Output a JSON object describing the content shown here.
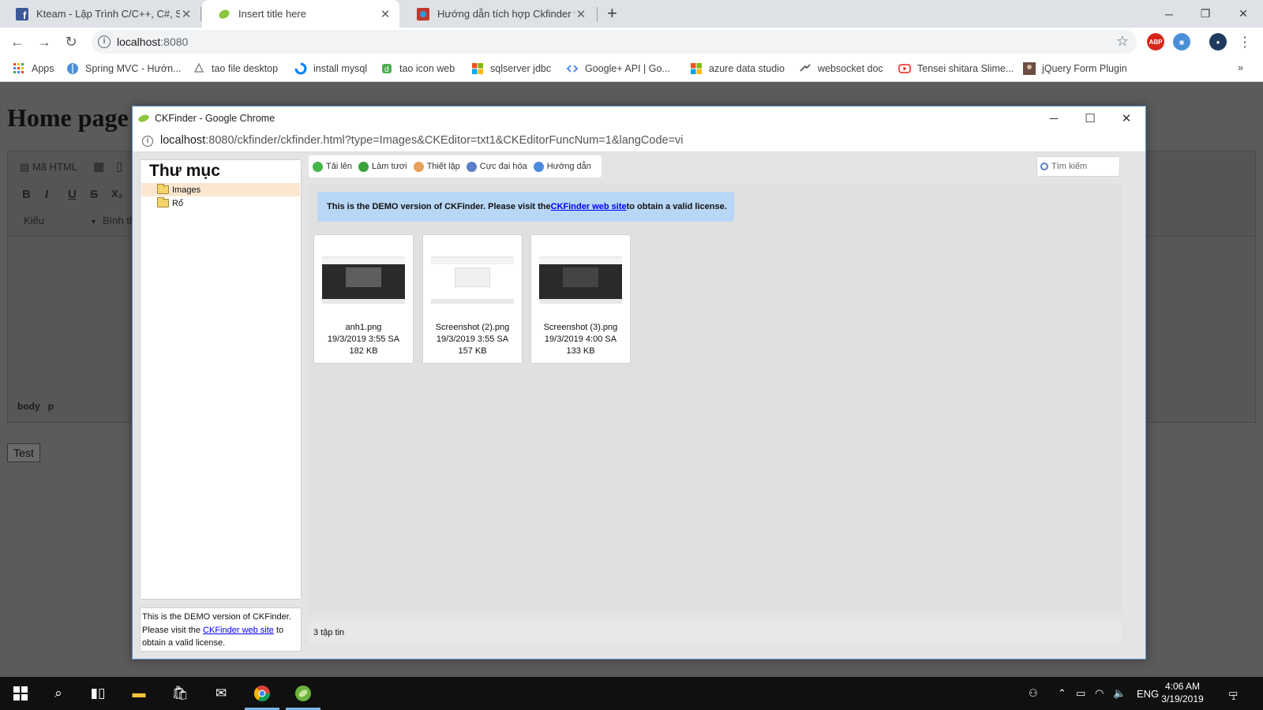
{
  "browser": {
    "tabs": [
      {
        "title": "Kteam - Lập Trình C/C++, C#, SQL",
        "icon": "facebook-icon",
        "active": false
      },
      {
        "title": "Insert title here",
        "icon": "spring-leaf-icon",
        "active": true
      },
      {
        "title": "Hướng dẫn tích hợp Ckfinder vào",
        "icon": "howkteam-icon",
        "active": false
      }
    ],
    "url_host": "localhost",
    "url_port": ":8080",
    "bookmarks": [
      {
        "label": "Apps",
        "icon": "apps-grid-icon"
      },
      {
        "label": "Spring MVC - Hướn...",
        "icon": "globe-icon"
      },
      {
        "label": "tao file desktop",
        "icon": "recycle-icon"
      },
      {
        "label": "install mysql",
        "icon": "digitalocean-icon"
      },
      {
        "label": "tao icon web",
        "icon": "d-logo-icon"
      },
      {
        "label": "sqlserver jdbc",
        "icon": "microsoft-icon"
      },
      {
        "label": "Google+ API | Go...",
        "icon": "code-icon"
      },
      {
        "label": "azure data studio",
        "icon": "microsoft-icon"
      },
      {
        "label": "websocket doc",
        "icon": "websocket-icon"
      },
      {
        "label": "Tensei shitara Slime...",
        "icon": "youtube-icon"
      },
      {
        "label": "jQuery Form Plugin",
        "icon": "avatar-icon"
      }
    ],
    "more_bookmarks": "»"
  },
  "page": {
    "heading": "Home page",
    "editor": {
      "source_label": "Mã HTML",
      "format_buttons": [
        "B",
        "I",
        "U",
        "S",
        "X₂"
      ],
      "style_label": "Kiểu",
      "format_label": "Bình th",
      "path": [
        "body",
        "p"
      ]
    },
    "test_button": "Test"
  },
  "ckfinder": {
    "window_title": "CKFinder - Google Chrome",
    "url_host": "localhost",
    "url_rest": ":8080/ckfinder/ckfinder.html?type=Images&CKEditor=txt1&CKEditorFuncNum=1&langCode=vi",
    "folders_title": "Thư mục",
    "folders": [
      {
        "name": "Images",
        "selected": true
      },
      {
        "name": "Rổ",
        "selected": false
      }
    ],
    "toolbar": [
      {
        "label": "Tải lên",
        "icon": "upload-icon",
        "color": "#45b549"
      },
      {
        "label": "Làm tươi",
        "icon": "refresh-icon",
        "color": "#3aa03a"
      },
      {
        "label": "Thiết lập",
        "icon": "settings-wrench-icon",
        "color": "#e6a05a"
      },
      {
        "label": "Cực đại hóa",
        "icon": "maximize-icon",
        "color": "#5a7fc8"
      },
      {
        "label": "Hướng dẫn",
        "icon": "help-icon",
        "color": "#4a8be0"
      }
    ],
    "search_placeholder": "Tìm kiếm",
    "banner": {
      "before": "This is the DEMO version of CKFinder. Please visit the ",
      "link": "CKFinder web site",
      "after": " to obtain a valid license."
    },
    "sidebar_demo": {
      "before": "This is the DEMO version of CKFinder. Please visit the ",
      "link": "CKFinder web site",
      "after": " to obtain a valid license."
    },
    "files": [
      {
        "name": "anh1.png",
        "date": "19/3/2019 3:55 SA",
        "size": "182 KB",
        "theme": "dark"
      },
      {
        "name": "Screenshot (2).png",
        "date": "19/3/2019 3:55 SA",
        "size": "157 KB",
        "theme": "light"
      },
      {
        "name": "Screenshot (3).png",
        "date": "19/3/2019 4:00 SA",
        "size": "133 KB",
        "theme": "dark"
      }
    ],
    "status": "3 tập tin"
  },
  "taskbar": {
    "language": "ENG",
    "time": "4:06 AM",
    "date": "3/19/2019",
    "notification_count": "1"
  }
}
